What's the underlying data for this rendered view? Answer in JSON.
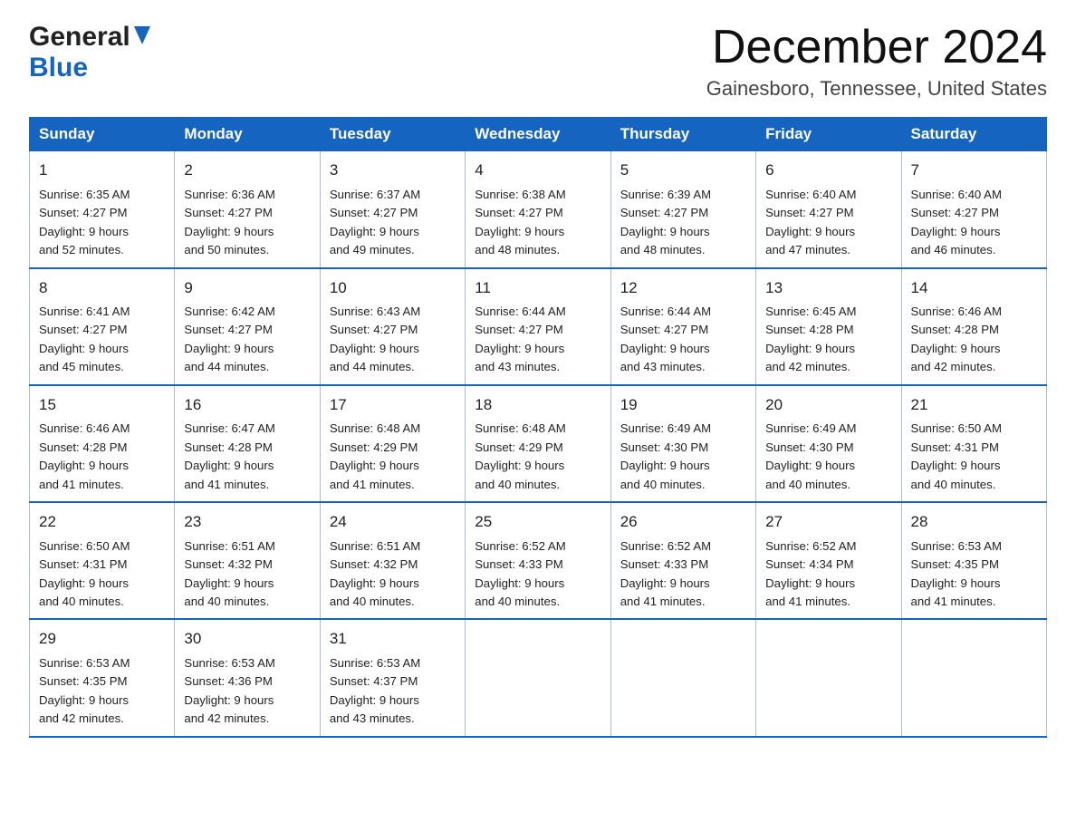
{
  "logo": {
    "general": "General",
    "blue": "Blue",
    "triangle_unicode": "▶"
  },
  "title": "December 2024",
  "location": "Gainesboro, Tennessee, United States",
  "days_of_week": [
    "Sunday",
    "Monday",
    "Tuesday",
    "Wednesday",
    "Thursday",
    "Friday",
    "Saturday"
  ],
  "weeks": [
    [
      {
        "day": "1",
        "sunrise": "Sunrise: 6:35 AM",
        "sunset": "Sunset: 4:27 PM",
        "daylight": "Daylight: 9 hours",
        "daylight2": "and 52 minutes."
      },
      {
        "day": "2",
        "sunrise": "Sunrise: 6:36 AM",
        "sunset": "Sunset: 4:27 PM",
        "daylight": "Daylight: 9 hours",
        "daylight2": "and 50 minutes."
      },
      {
        "day": "3",
        "sunrise": "Sunrise: 6:37 AM",
        "sunset": "Sunset: 4:27 PM",
        "daylight": "Daylight: 9 hours",
        "daylight2": "and 49 minutes."
      },
      {
        "day": "4",
        "sunrise": "Sunrise: 6:38 AM",
        "sunset": "Sunset: 4:27 PM",
        "daylight": "Daylight: 9 hours",
        "daylight2": "and 48 minutes."
      },
      {
        "day": "5",
        "sunrise": "Sunrise: 6:39 AM",
        "sunset": "Sunset: 4:27 PM",
        "daylight": "Daylight: 9 hours",
        "daylight2": "and 48 minutes."
      },
      {
        "day": "6",
        "sunrise": "Sunrise: 6:40 AM",
        "sunset": "Sunset: 4:27 PM",
        "daylight": "Daylight: 9 hours",
        "daylight2": "and 47 minutes."
      },
      {
        "day": "7",
        "sunrise": "Sunrise: 6:40 AM",
        "sunset": "Sunset: 4:27 PM",
        "daylight": "Daylight: 9 hours",
        "daylight2": "and 46 minutes."
      }
    ],
    [
      {
        "day": "8",
        "sunrise": "Sunrise: 6:41 AM",
        "sunset": "Sunset: 4:27 PM",
        "daylight": "Daylight: 9 hours",
        "daylight2": "and 45 minutes."
      },
      {
        "day": "9",
        "sunrise": "Sunrise: 6:42 AM",
        "sunset": "Sunset: 4:27 PM",
        "daylight": "Daylight: 9 hours",
        "daylight2": "and 44 minutes."
      },
      {
        "day": "10",
        "sunrise": "Sunrise: 6:43 AM",
        "sunset": "Sunset: 4:27 PM",
        "daylight": "Daylight: 9 hours",
        "daylight2": "and 44 minutes."
      },
      {
        "day": "11",
        "sunrise": "Sunrise: 6:44 AM",
        "sunset": "Sunset: 4:27 PM",
        "daylight": "Daylight: 9 hours",
        "daylight2": "and 43 minutes."
      },
      {
        "day": "12",
        "sunrise": "Sunrise: 6:44 AM",
        "sunset": "Sunset: 4:27 PM",
        "daylight": "Daylight: 9 hours",
        "daylight2": "and 43 minutes."
      },
      {
        "day": "13",
        "sunrise": "Sunrise: 6:45 AM",
        "sunset": "Sunset: 4:28 PM",
        "daylight": "Daylight: 9 hours",
        "daylight2": "and 42 minutes."
      },
      {
        "day": "14",
        "sunrise": "Sunrise: 6:46 AM",
        "sunset": "Sunset: 4:28 PM",
        "daylight": "Daylight: 9 hours",
        "daylight2": "and 42 minutes."
      }
    ],
    [
      {
        "day": "15",
        "sunrise": "Sunrise: 6:46 AM",
        "sunset": "Sunset: 4:28 PM",
        "daylight": "Daylight: 9 hours",
        "daylight2": "and 41 minutes."
      },
      {
        "day": "16",
        "sunrise": "Sunrise: 6:47 AM",
        "sunset": "Sunset: 4:28 PM",
        "daylight": "Daylight: 9 hours",
        "daylight2": "and 41 minutes."
      },
      {
        "day": "17",
        "sunrise": "Sunrise: 6:48 AM",
        "sunset": "Sunset: 4:29 PM",
        "daylight": "Daylight: 9 hours",
        "daylight2": "and 41 minutes."
      },
      {
        "day": "18",
        "sunrise": "Sunrise: 6:48 AM",
        "sunset": "Sunset: 4:29 PM",
        "daylight": "Daylight: 9 hours",
        "daylight2": "and 40 minutes."
      },
      {
        "day": "19",
        "sunrise": "Sunrise: 6:49 AM",
        "sunset": "Sunset: 4:30 PM",
        "daylight": "Daylight: 9 hours",
        "daylight2": "and 40 minutes."
      },
      {
        "day": "20",
        "sunrise": "Sunrise: 6:49 AM",
        "sunset": "Sunset: 4:30 PM",
        "daylight": "Daylight: 9 hours",
        "daylight2": "and 40 minutes."
      },
      {
        "day": "21",
        "sunrise": "Sunrise: 6:50 AM",
        "sunset": "Sunset: 4:31 PM",
        "daylight": "Daylight: 9 hours",
        "daylight2": "and 40 minutes."
      }
    ],
    [
      {
        "day": "22",
        "sunrise": "Sunrise: 6:50 AM",
        "sunset": "Sunset: 4:31 PM",
        "daylight": "Daylight: 9 hours",
        "daylight2": "and 40 minutes."
      },
      {
        "day": "23",
        "sunrise": "Sunrise: 6:51 AM",
        "sunset": "Sunset: 4:32 PM",
        "daylight": "Daylight: 9 hours",
        "daylight2": "and 40 minutes."
      },
      {
        "day": "24",
        "sunrise": "Sunrise: 6:51 AM",
        "sunset": "Sunset: 4:32 PM",
        "daylight": "Daylight: 9 hours",
        "daylight2": "and 40 minutes."
      },
      {
        "day": "25",
        "sunrise": "Sunrise: 6:52 AM",
        "sunset": "Sunset: 4:33 PM",
        "daylight": "Daylight: 9 hours",
        "daylight2": "and 40 minutes."
      },
      {
        "day": "26",
        "sunrise": "Sunrise: 6:52 AM",
        "sunset": "Sunset: 4:33 PM",
        "daylight": "Daylight: 9 hours",
        "daylight2": "and 41 minutes."
      },
      {
        "day": "27",
        "sunrise": "Sunrise: 6:52 AM",
        "sunset": "Sunset: 4:34 PM",
        "daylight": "Daylight: 9 hours",
        "daylight2": "and 41 minutes."
      },
      {
        "day": "28",
        "sunrise": "Sunrise: 6:53 AM",
        "sunset": "Sunset: 4:35 PM",
        "daylight": "Daylight: 9 hours",
        "daylight2": "and 41 minutes."
      }
    ],
    [
      {
        "day": "29",
        "sunrise": "Sunrise: 6:53 AM",
        "sunset": "Sunset: 4:35 PM",
        "daylight": "Daylight: 9 hours",
        "daylight2": "and 42 minutes."
      },
      {
        "day": "30",
        "sunrise": "Sunrise: 6:53 AM",
        "sunset": "Sunset: 4:36 PM",
        "daylight": "Daylight: 9 hours",
        "daylight2": "and 42 minutes."
      },
      {
        "day": "31",
        "sunrise": "Sunrise: 6:53 AM",
        "sunset": "Sunset: 4:37 PM",
        "daylight": "Daylight: 9 hours",
        "daylight2": "and 43 minutes."
      },
      {
        "day": "",
        "sunrise": "",
        "sunset": "",
        "daylight": "",
        "daylight2": ""
      },
      {
        "day": "",
        "sunrise": "",
        "sunset": "",
        "daylight": "",
        "daylight2": ""
      },
      {
        "day": "",
        "sunrise": "",
        "sunset": "",
        "daylight": "",
        "daylight2": ""
      },
      {
        "day": "",
        "sunrise": "",
        "sunset": "",
        "daylight": "",
        "daylight2": ""
      }
    ]
  ]
}
